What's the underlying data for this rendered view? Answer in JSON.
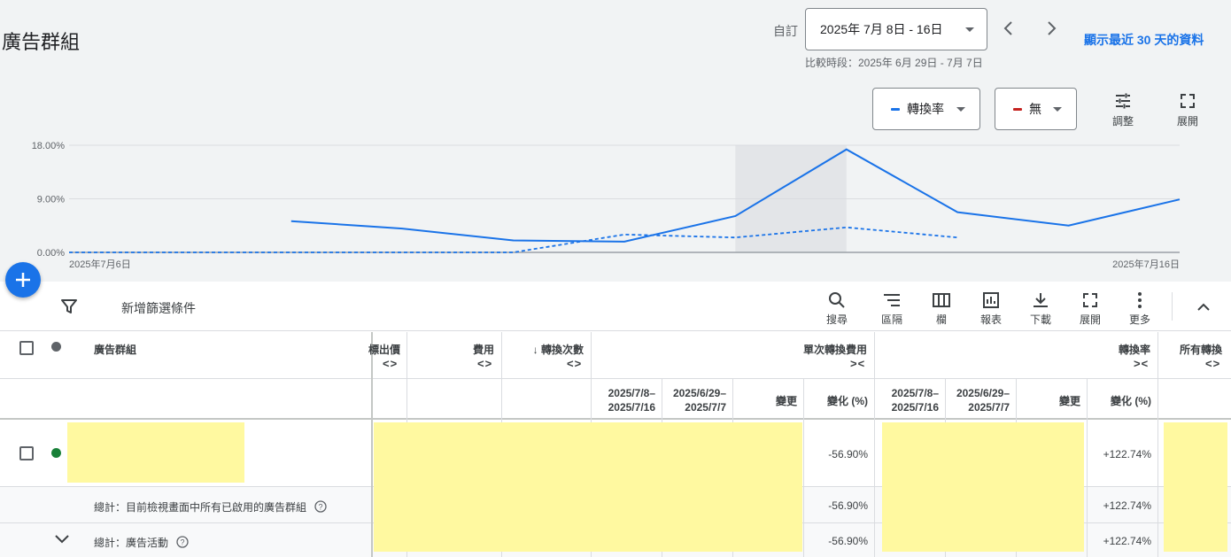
{
  "header": {
    "title": "廣告群組",
    "custom_label": "自訂",
    "date_range": "2025年 7月 8日 - 16日",
    "compare_text": "比較時段：2025年 6月 29日 - 7月 7日",
    "last30_link": "顯示最近 30 天的資料"
  },
  "chart_controls": {
    "metric1": {
      "label": "轉換率",
      "color": "#1a73e8"
    },
    "metric2": {
      "label": "無",
      "color": "#c5221f"
    },
    "adjust_label": "調整",
    "expand_label": "展開"
  },
  "chart_data": {
    "type": "line",
    "x_start_label": "2025年7月6日",
    "x_end_label": "2025年7月16日",
    "y_ticks": [
      "18.00%",
      "9.00%",
      "0.00%"
    ],
    "ylim": [
      0,
      18
    ],
    "x": [
      6,
      7,
      8,
      9,
      10,
      11,
      12,
      13,
      14,
      15,
      16
    ],
    "series": [
      {
        "style": "solid",
        "color": "#1a73e8",
        "values": [
          null,
          null,
          5.25,
          4.0,
          2.0,
          1.8,
          6.1,
          17.3,
          6.75,
          4.5,
          8.9
        ]
      },
      {
        "style": "dashed",
        "color": "#1a73e8",
        "values": [
          0,
          0,
          0,
          0,
          0,
          3.0,
          2.5,
          4.2,
          2.5,
          null,
          null
        ]
      }
    ],
    "highlight_x": 13
  },
  "toolbar": {
    "filter_label": "新增篩選條件",
    "search": "搜尋",
    "segment": "區隔",
    "columns": "欄",
    "reports": "報表",
    "download": "下載",
    "expand": "展開",
    "more": "更多"
  },
  "table": {
    "col_name": "廣告群組",
    "col_bid": "標出價",
    "col_cost": "費用",
    "col_conversions": "轉換次數",
    "col_cpa": "單次轉換費用",
    "col_conv_rate": "轉換率",
    "col_all_conv": "所有轉換",
    "sub_period1": "2025/7/8–2025/7/16",
    "sub_period2": "2025/6/29–2025/7/7",
    "sub_change": "變更",
    "sub_change_pct": "變化 (%)",
    "rows": [
      {
        "cpa_change_pct": "-56.90%",
        "conv_rate_change_pct": "+122.74%"
      }
    ],
    "total_enabled_label": "總計：目前檢視畫面中所有已啟用的廣告群組",
    "total_enabled_cpa_pct": "-56.90%",
    "total_enabled_rate_pct": "+122.74%",
    "total_campaign_label": "總計：廣告活動",
    "total_campaign_cpa_pct": "-56.90%",
    "total_campaign_rate_pct": "+122.74%"
  }
}
